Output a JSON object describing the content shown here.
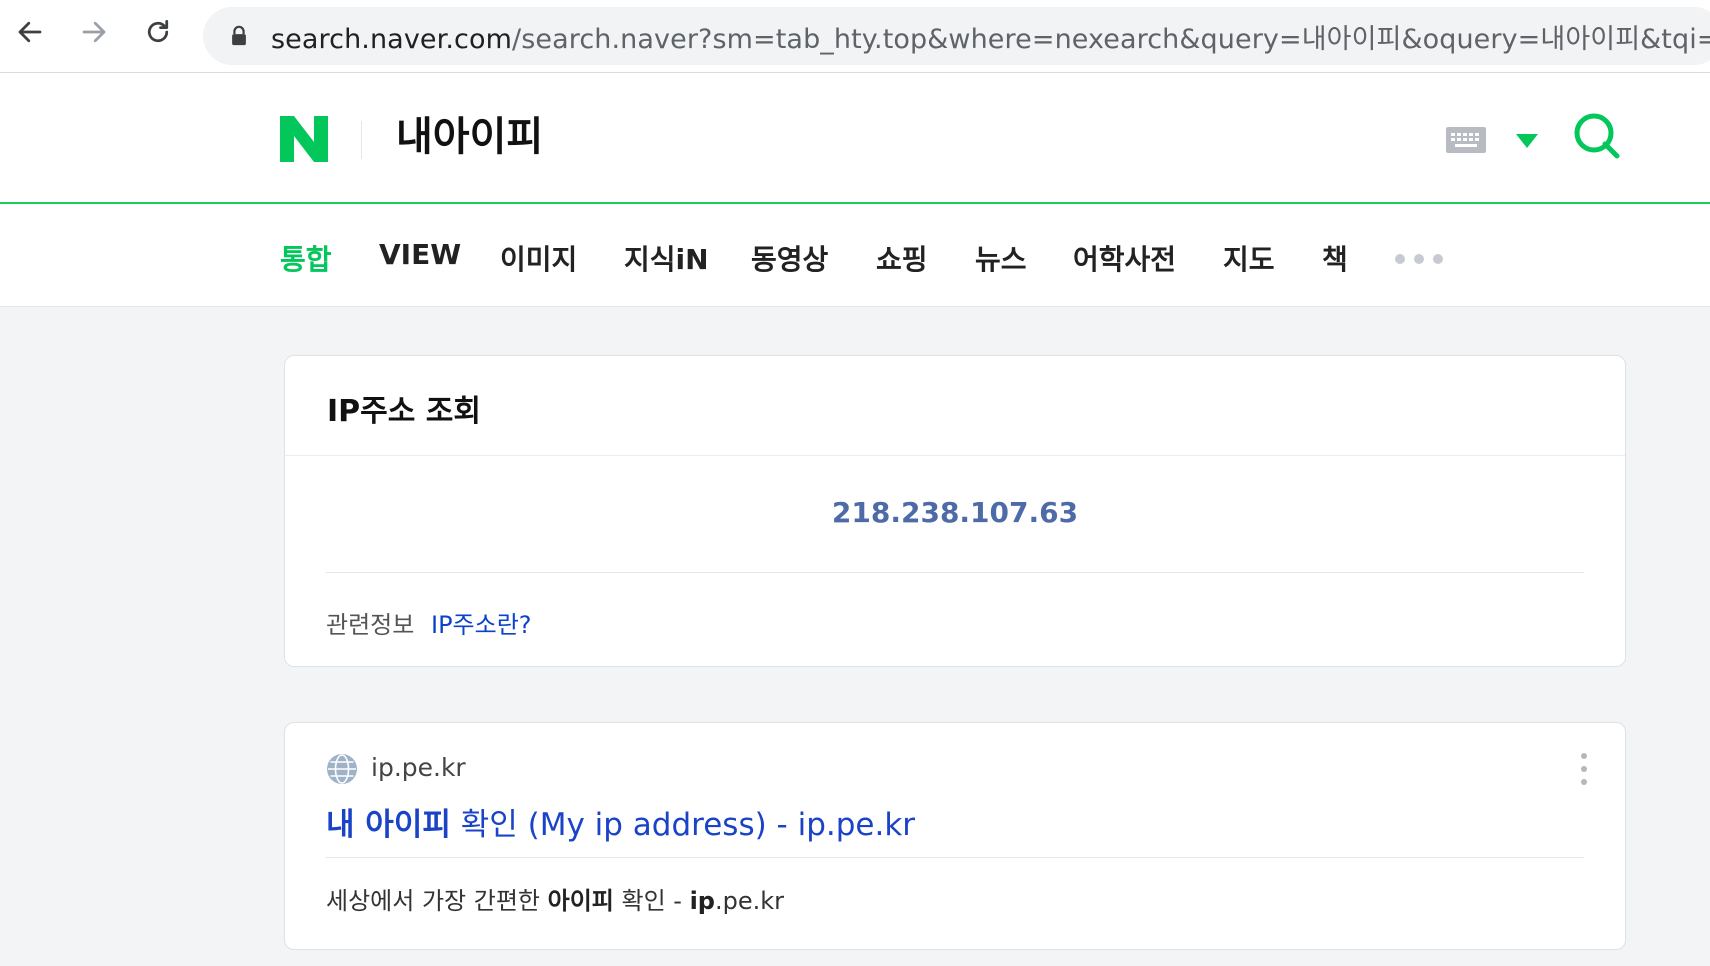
{
  "browser": {
    "url_host": "search.naver.com",
    "url_rest": "/search.naver?sm=tab_hty.top&where=nexearch&query=내아이피&oquery=내아이피&tqi=hMX",
    "icons": [
      "back-arrow-icon",
      "forward-arrow-icon",
      "reload-icon",
      "lock-icon"
    ]
  },
  "header": {
    "logo_letter": "N",
    "query": "내아이피",
    "icons": [
      "keyboard-icon",
      "dropdown-caret-icon",
      "search-icon"
    ],
    "accent_color": "#03c75a"
  },
  "tabs": [
    {
      "label": "통합",
      "active": true
    },
    {
      "label": "VIEW",
      "active": false
    },
    {
      "label": "이미지",
      "active": false
    },
    {
      "label": "지식iN",
      "active": false
    },
    {
      "label": "동영상",
      "active": false
    },
    {
      "label": "쇼핑",
      "active": false
    },
    {
      "label": "뉴스",
      "active": false
    },
    {
      "label": "어학사전",
      "active": false
    },
    {
      "label": "지도",
      "active": false
    },
    {
      "label": "책",
      "active": false
    }
  ],
  "ip_card": {
    "title": "IP주소 조회",
    "ip": "218.238.107.63",
    "related_label": "관련정보",
    "related_link": "IP주소란?",
    "ip_color": "#4e6ba8"
  },
  "result": {
    "site": "ip.pe.kr",
    "title_bold": "내 아이피",
    "title_rest": " 확인 (My ip address) - ip.pe.kr",
    "snippet_pre": "세상에서 가장 간편한 ",
    "snippet_bold1": "아이피",
    "snippet_mid": " 확인 - ",
    "snippet_bold2": "ip",
    "snippet_post": ".pe.kr",
    "icons": [
      "globe-icon",
      "more-options-icon"
    ]
  }
}
